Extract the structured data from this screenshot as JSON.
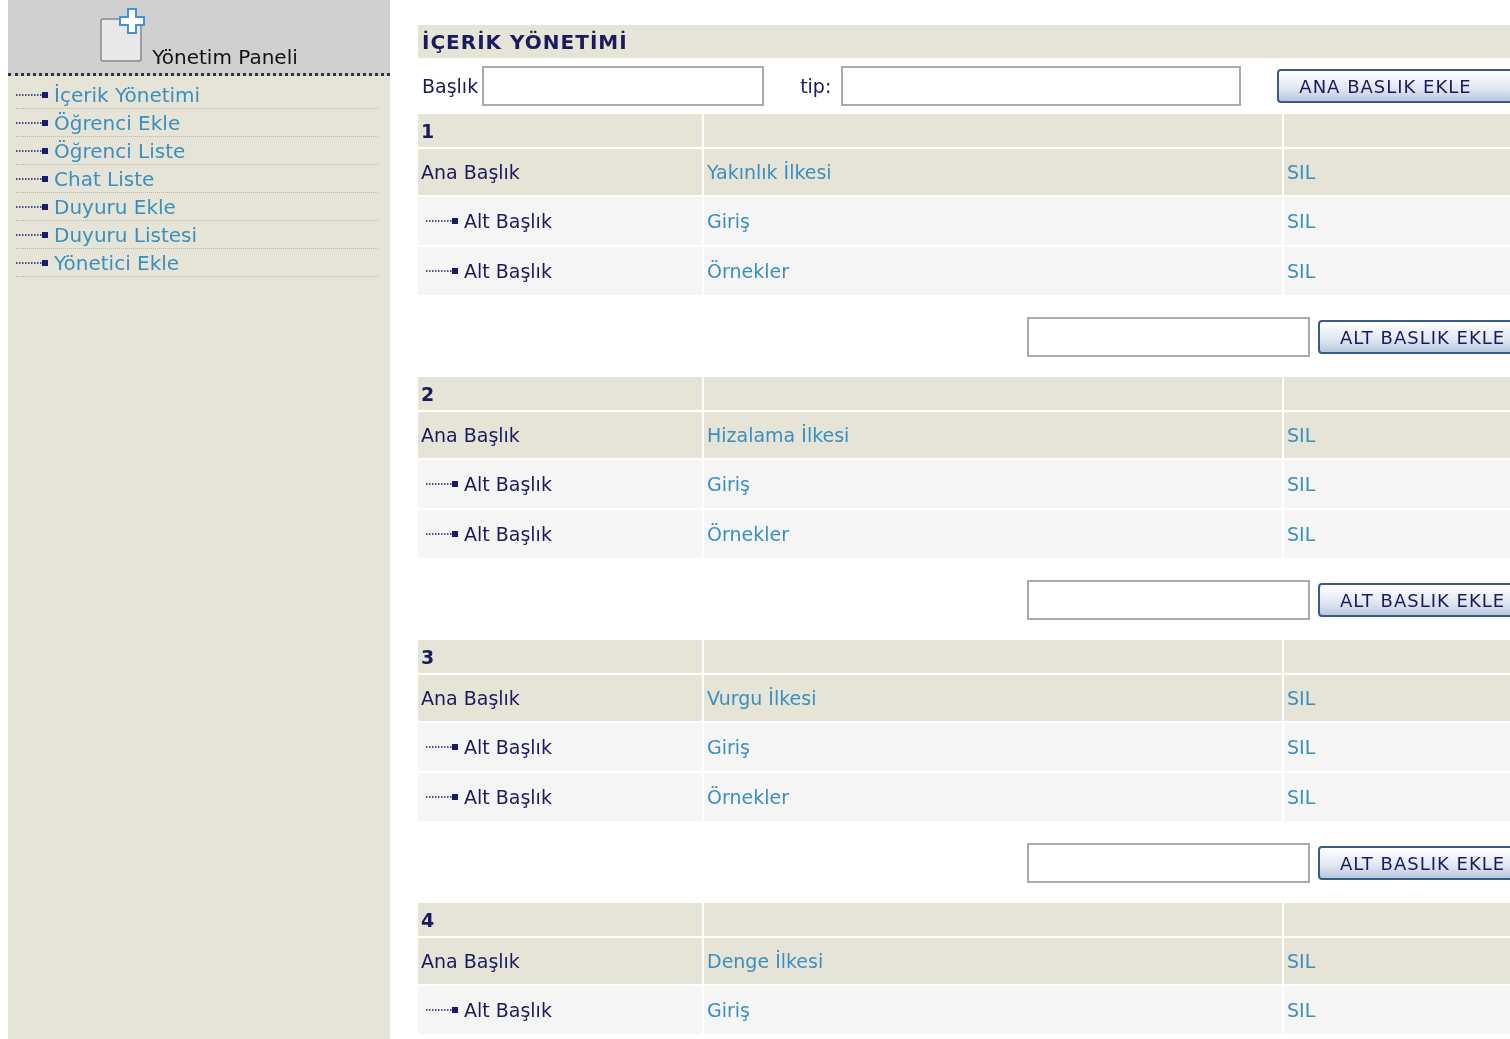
{
  "sidebar": {
    "title": "Yönetim Paneli",
    "items": [
      {
        "label": "İçerik Yönetimi"
      },
      {
        "label": "Öğrenci Ekle"
      },
      {
        "label": "Öğrenci Liste"
      },
      {
        "label": "Chat Liste"
      },
      {
        "label": "Duyuru Ekle"
      },
      {
        "label": "Duyuru Listesi"
      },
      {
        "label": "Yönetici Ekle"
      }
    ]
  },
  "content": {
    "title": "İÇERİK YÖNETİMİ",
    "form": {
      "title_label": "Başlık",
      "type_label": "tip:",
      "button": "ANA BASLIK EKLE"
    },
    "sections": [
      {
        "number": "1",
        "main": {
          "label": "Ana Başlık",
          "title": "Yakınlık İlkesi",
          "delete": "SIL"
        },
        "subs": [
          {
            "label": "Alt Başlık",
            "title": "Giriş",
            "delete": "SIL"
          },
          {
            "label": "Alt Başlık",
            "title": "Örnekler",
            "delete": "SIL"
          }
        ],
        "add_button": "ALT BASLIK EKLE"
      },
      {
        "number": "2",
        "main": {
          "label": "Ana Başlık",
          "title": "Hizalama İlkesi",
          "delete": "SIL"
        },
        "subs": [
          {
            "label": "Alt Başlık",
            "title": "Giriş",
            "delete": "SIL"
          },
          {
            "label": "Alt Başlık",
            "title": "Örnekler",
            "delete": "SIL"
          }
        ],
        "add_button": "ALT BASLIK EKLE"
      },
      {
        "number": "3",
        "main": {
          "label": "Ana Başlık",
          "title": "Vurgu İlkesi",
          "delete": "SIL"
        },
        "subs": [
          {
            "label": "Alt Başlık",
            "title": "Giriş",
            "delete": "SIL"
          },
          {
            "label": "Alt Başlık",
            "title": "Örnekler",
            "delete": "SIL"
          }
        ],
        "add_button": "ALT BASLIK EKLE"
      },
      {
        "number": "4",
        "main": {
          "label": "Ana Başlık",
          "title": "Denge İlkesi",
          "delete": "SIL"
        },
        "subs": [
          {
            "label": "Alt Başlık",
            "title": "Giriş",
            "delete": "SIL"
          }
        ]
      }
    ]
  }
}
